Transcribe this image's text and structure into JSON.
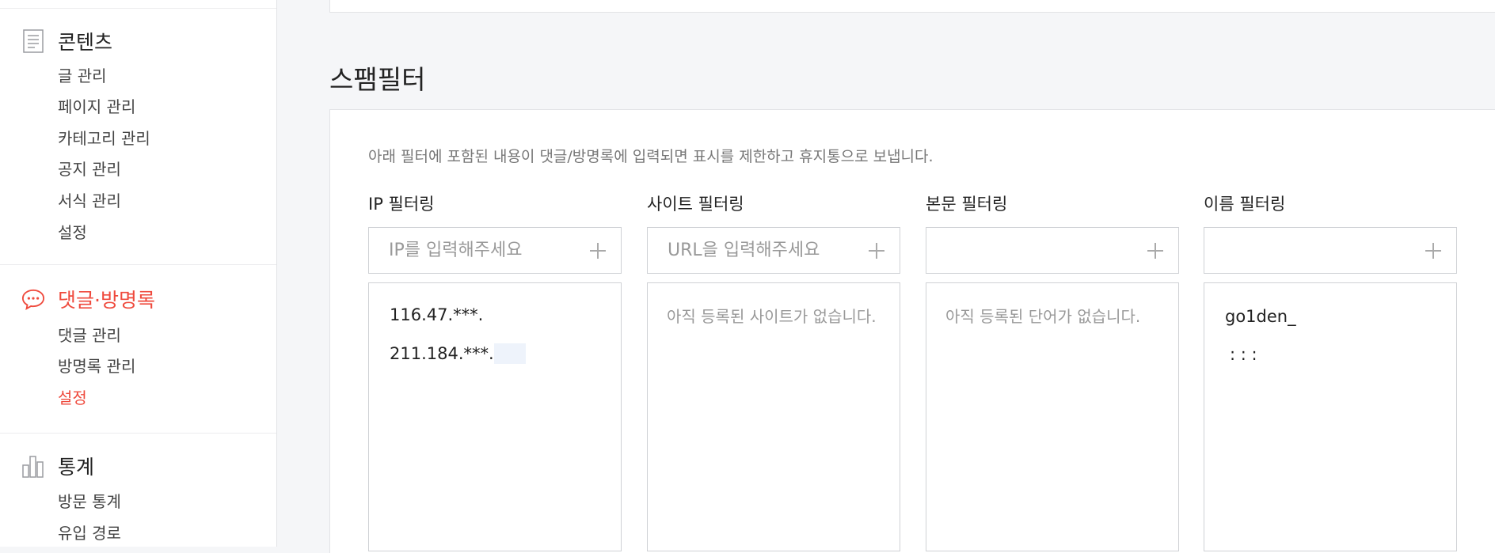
{
  "sidebar": {
    "sections": [
      {
        "title": "콘텐츠",
        "icon": "document-icon",
        "active": false,
        "items": [
          {
            "label": "글 관리",
            "active": false
          },
          {
            "label": "페이지 관리",
            "active": false
          },
          {
            "label": "카테고리 관리",
            "active": false
          },
          {
            "label": "공지 관리",
            "active": false
          },
          {
            "label": "서식 관리",
            "active": false
          },
          {
            "label": "설정",
            "active": false
          }
        ]
      },
      {
        "title": "댓글·방명록",
        "icon": "speech-bubble-icon",
        "active": true,
        "items": [
          {
            "label": "댓글 관리",
            "active": false
          },
          {
            "label": "방명록 관리",
            "active": false
          },
          {
            "label": "설정",
            "active": true
          }
        ]
      },
      {
        "title": "통계",
        "icon": "bar-chart-icon",
        "active": false,
        "items": [
          {
            "label": "방문 통계",
            "active": false
          },
          {
            "label": "유입 경로",
            "active": false
          }
        ]
      }
    ]
  },
  "main": {
    "title": "스팸필터",
    "description": "아래 필터에 포함된 내용이 댓글/방명록에 입력되면 표시를 제한하고 휴지통으로 보냅니다.",
    "filters": [
      {
        "title": "IP 필터링",
        "placeholder": "IP를 입력해주세요",
        "entries": [
          "116.47.***.",
          "211.184.***."
        ],
        "empty_message": ""
      },
      {
        "title": "사이트 필터링",
        "placeholder": "URL을 입력해주세요",
        "entries": [],
        "empty_message": "아직 등록된 사이트가 없습니다."
      },
      {
        "title": "본문 필터링",
        "placeholder": "",
        "entries": [],
        "empty_message": "아직 등록된 단어가 없습니다."
      },
      {
        "title": "이름 필터링",
        "placeholder": "",
        "entries": [
          "go1den_",
          ":  : :"
        ],
        "empty_message": ""
      }
    ]
  },
  "colors": {
    "accent": "#ef4a3d",
    "border": "#cfd1d5",
    "background": "#f5f6f8"
  }
}
